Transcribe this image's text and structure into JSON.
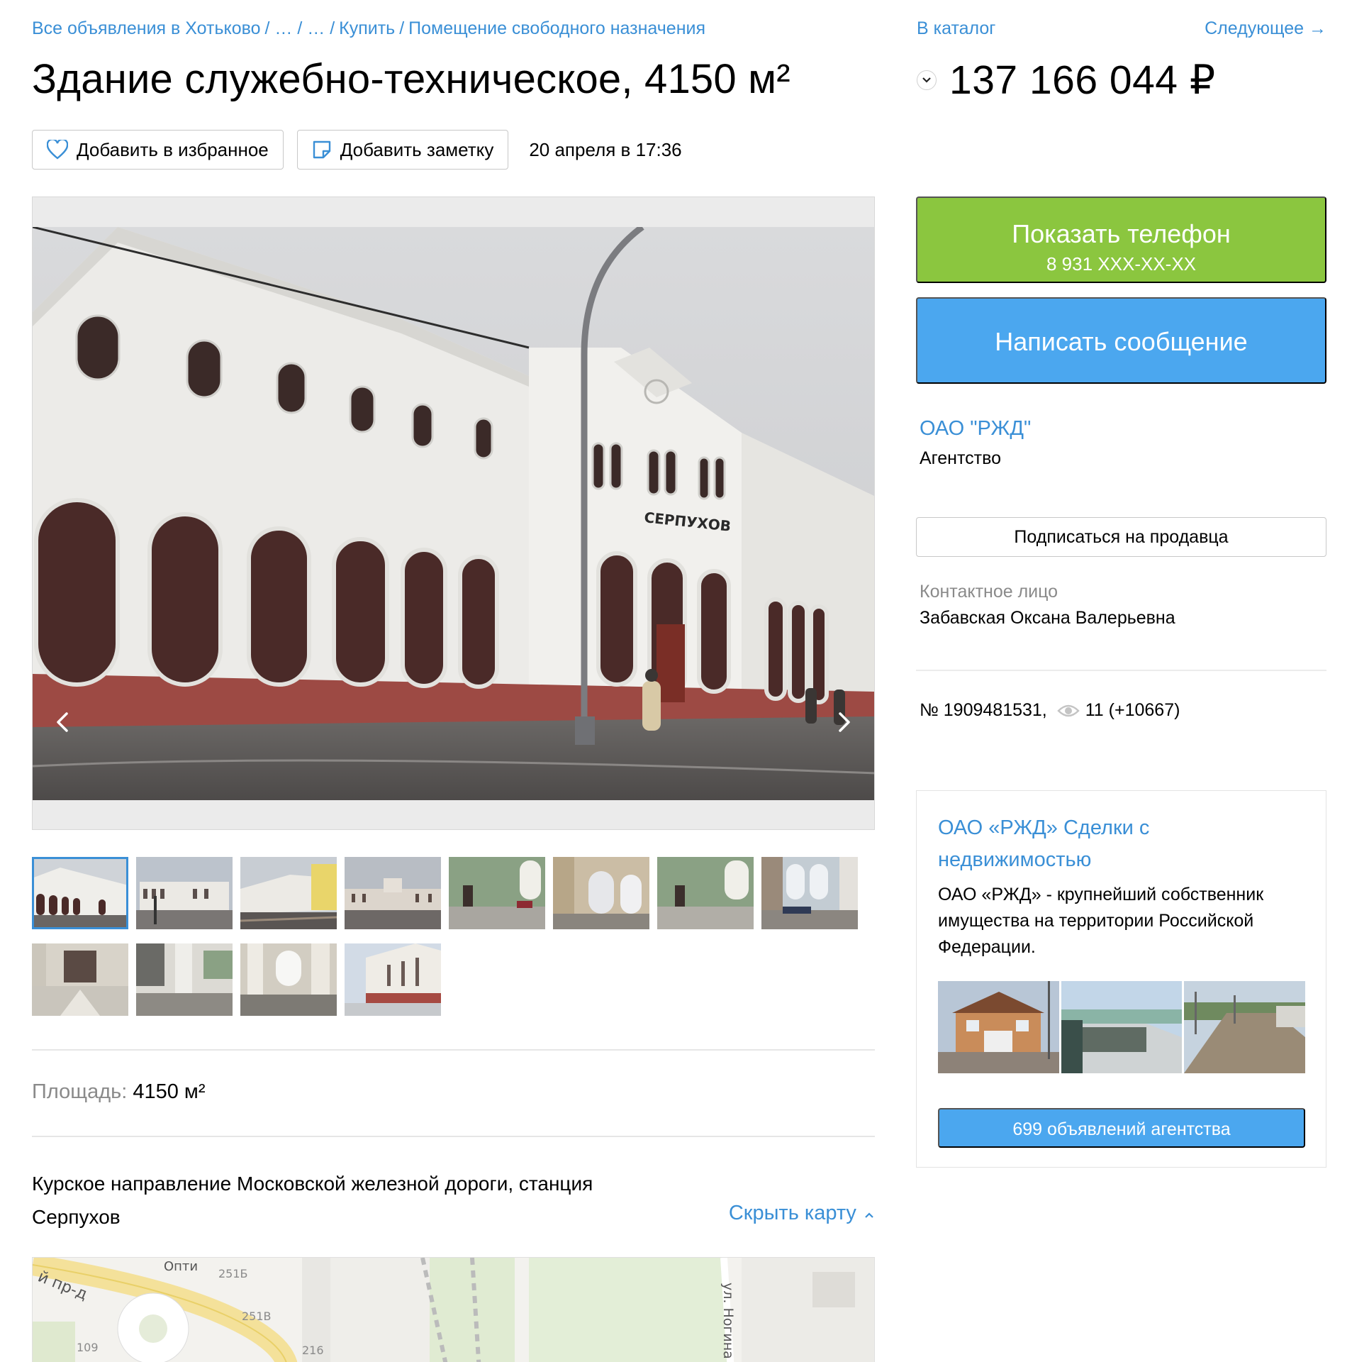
{
  "breadcrumb": {
    "all_ads": "Все объявления в Хотьково",
    "sep1": "/ … / … /",
    "buy": "Купить",
    "sep2": "/",
    "category": "Помещение свободного назначения"
  },
  "listing": {
    "title": "Здание служебно-техническое, 4150 м²",
    "favorite_label": "Добавить в избранное",
    "note_label": "Добавить заметку",
    "date": "20 апреля в 17:36",
    "area_label": "Площадь:",
    "area_value": "4150 м²",
    "address": "Курское направление Московской железной дороги, станция Серпухов",
    "hide_map": "Скрыть карту",
    "photo_sign": "СЕРПУХОВ",
    "thumbnail_count": 12,
    "active_thumbnail": 1
  },
  "map": {
    "labels": [
      "й пр-д",
      "Опти",
      "251Б",
      "251В",
      "109",
      "216",
      "ул. Ногина"
    ]
  },
  "sidebar": {
    "to_catalog": "В каталог",
    "next": "Следующее →",
    "price": "137 166 044 ₽",
    "show_phone": "Показать телефон",
    "phone_masked": "8 931 XXX-XX-XX",
    "write_message": "Написать сообщение",
    "seller_name": "ОАО \"РЖД\"",
    "seller_type": "Агентство",
    "subscribe": "Подписаться на продавца",
    "contact_label": "Контактное лицо",
    "contact_name": "Забавская Оксана Валерьевна",
    "ad_number": "№ 1909481531,",
    "views": "11 (+10667)"
  },
  "agency": {
    "title": "ОАО «РЖД» Сделки с недвижимостью",
    "description": "ОАО «РЖД» - крупнейший собственник имущества на территории Российской Федерации.",
    "ads_button": "699 объявлений агентства"
  },
  "colors": {
    "link": "#3a8fd6",
    "phone_button": "#8bc63f",
    "message_button": "#4ba7ef"
  }
}
